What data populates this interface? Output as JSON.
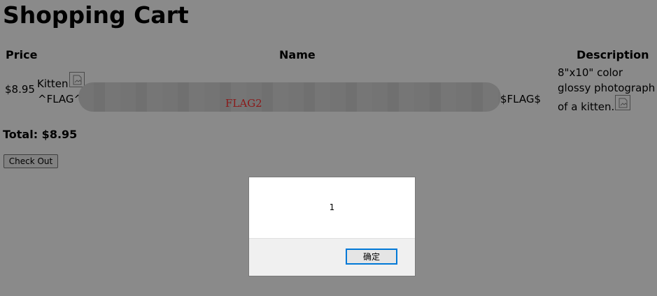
{
  "page": {
    "title": "Shopping Cart"
  },
  "table": {
    "headers": [
      "Price",
      "Name",
      "Description"
    ],
    "rows": [
      {
        "price": "$8.95",
        "name_line1": "Kitten",
        "name_dash": "—",
        "name_line2_start": "^FLAG^",
        "name_line2_end": "$FLAG$",
        "redaction_label": "FLAG2",
        "description_line1": "8\"x10\" color",
        "description_line2": "glossy photograph",
        "description_line3": "of a kitten."
      }
    ]
  },
  "total": {
    "text": "Total: $8.95"
  },
  "checkout": {
    "label": "Check Out"
  },
  "alert": {
    "message": "1",
    "ok_label": "确定"
  },
  "icons": {
    "broken_image": "broken-image-icon"
  },
  "colors": {
    "overlay": "#7f7f7f",
    "redaction_text": "#ff3030",
    "focus_border": "#0078d7"
  }
}
